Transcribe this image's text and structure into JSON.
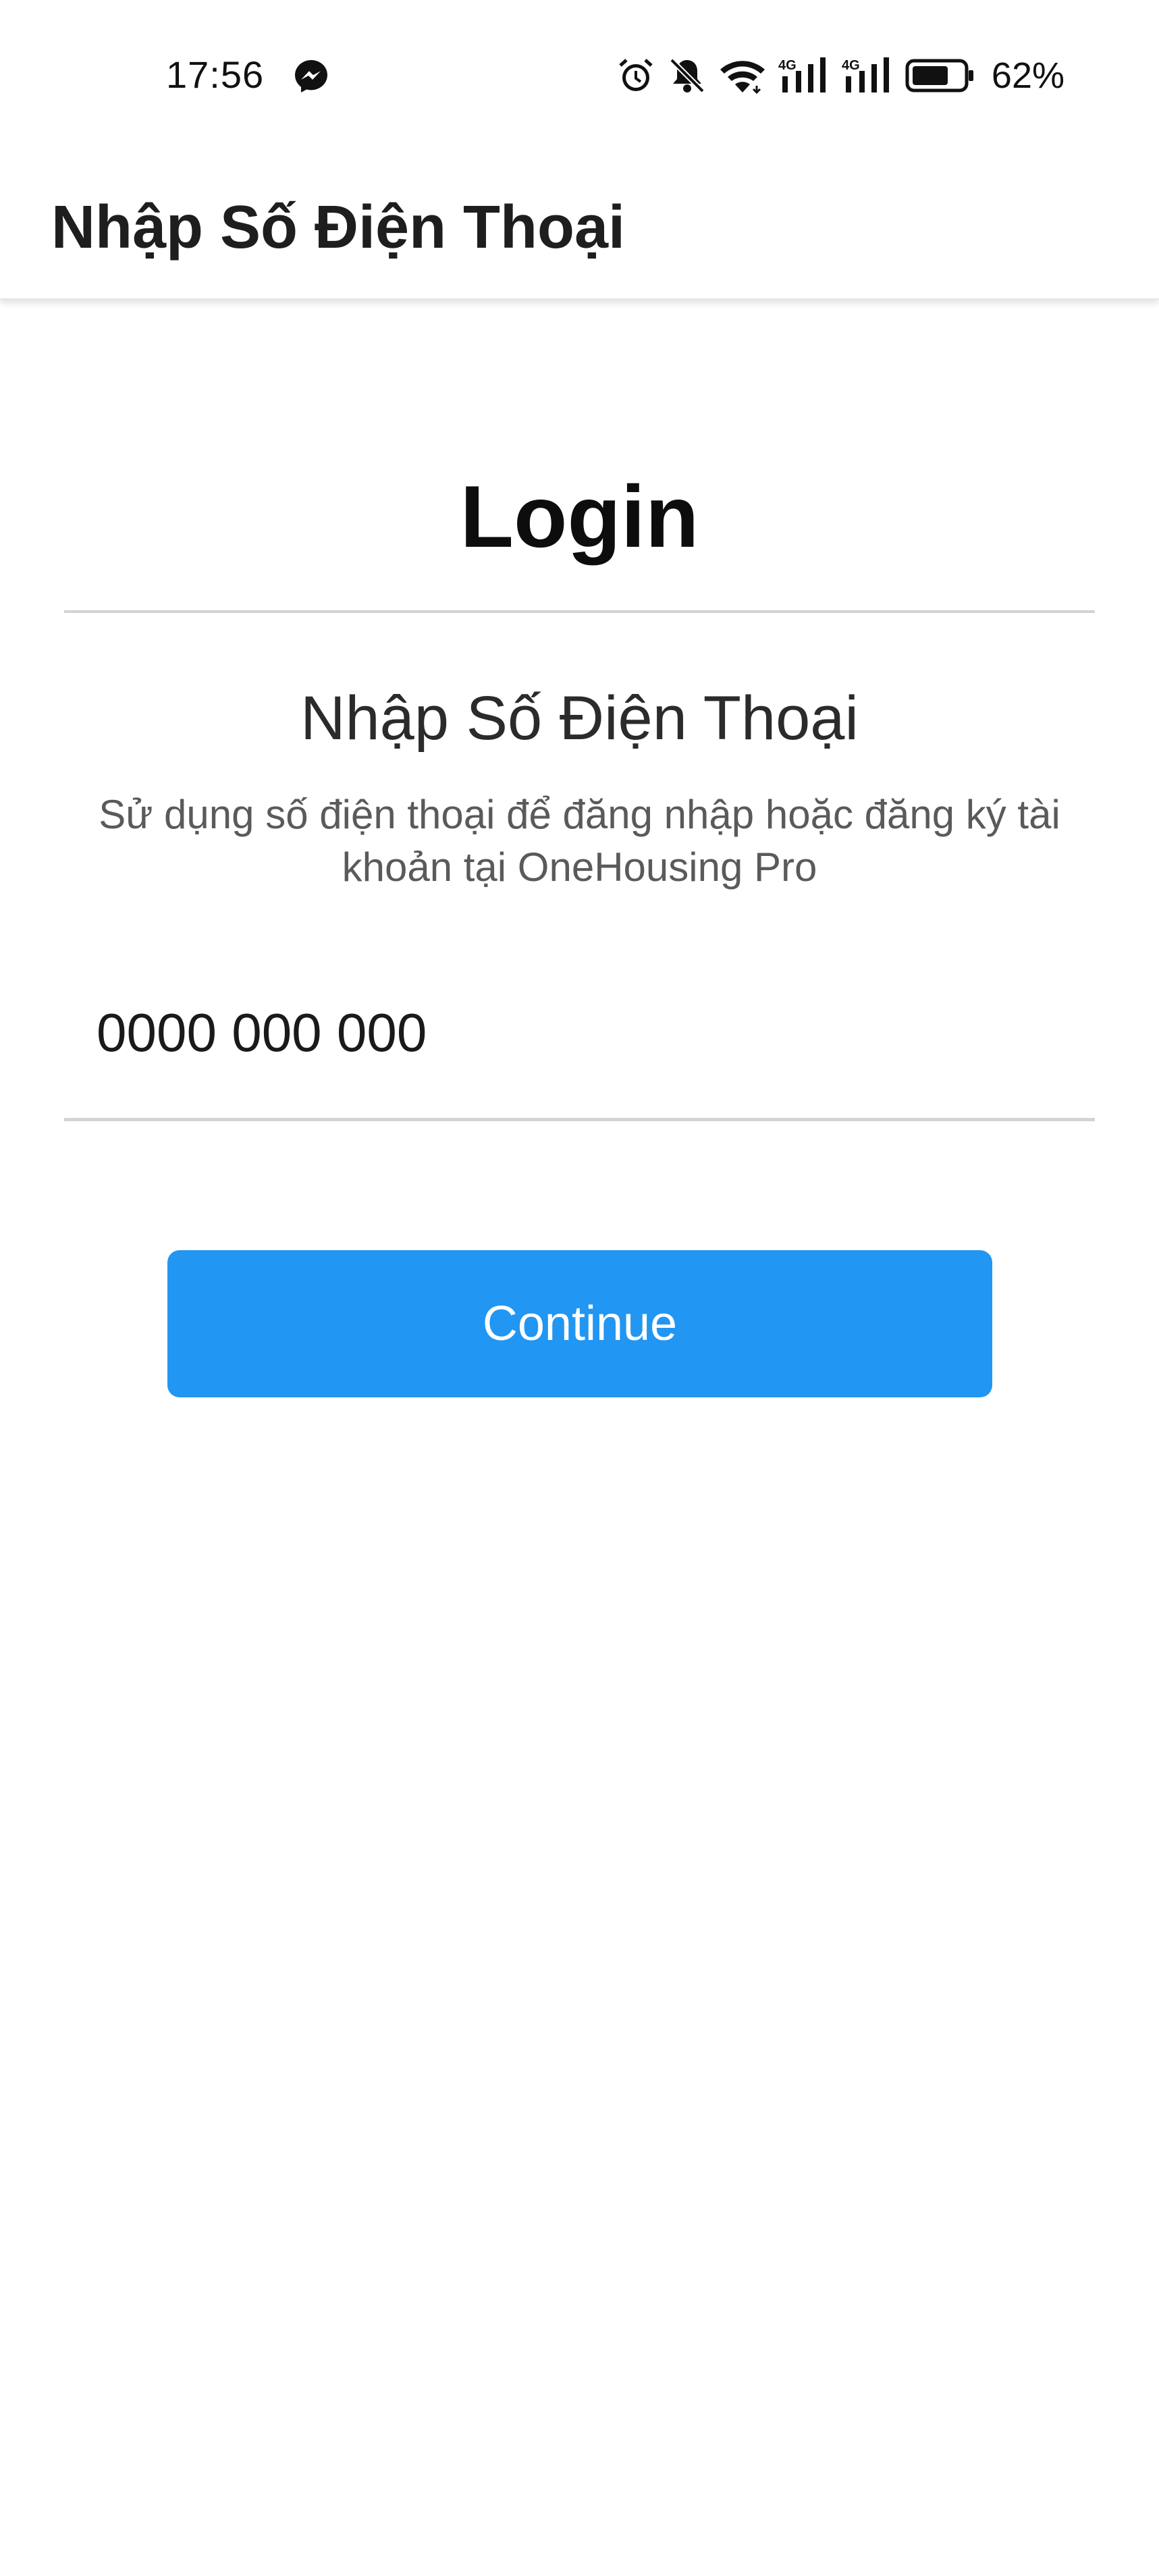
{
  "status_bar": {
    "time": "17:56",
    "battery_percent": "62%",
    "icons": [
      "messenger-icon",
      "alarm-icon",
      "mute-bell-icon",
      "wifi-icon",
      "signal-4g-icon",
      "signal-4g-icon",
      "battery-icon"
    ],
    "network_label_1": "4G",
    "network_label_2": "4G"
  },
  "app_bar": {
    "title": "Nhập Số Điện Thoại"
  },
  "content": {
    "login_title": "Login",
    "heading": "Nhập Số Điện Thoại",
    "subtitle": "Sử dụng số điện thoại để đăng nhập hoặc đăng ký tài khoản tại OneHousing Pro",
    "phone_placeholder": "0000 000 000",
    "phone_value": "",
    "continue_label": "Continue"
  },
  "colors": {
    "primary": "#2196f3",
    "divider": "#d3d3d3",
    "text_dark": "#1a1a1a",
    "text_muted": "#5a5a5a"
  }
}
